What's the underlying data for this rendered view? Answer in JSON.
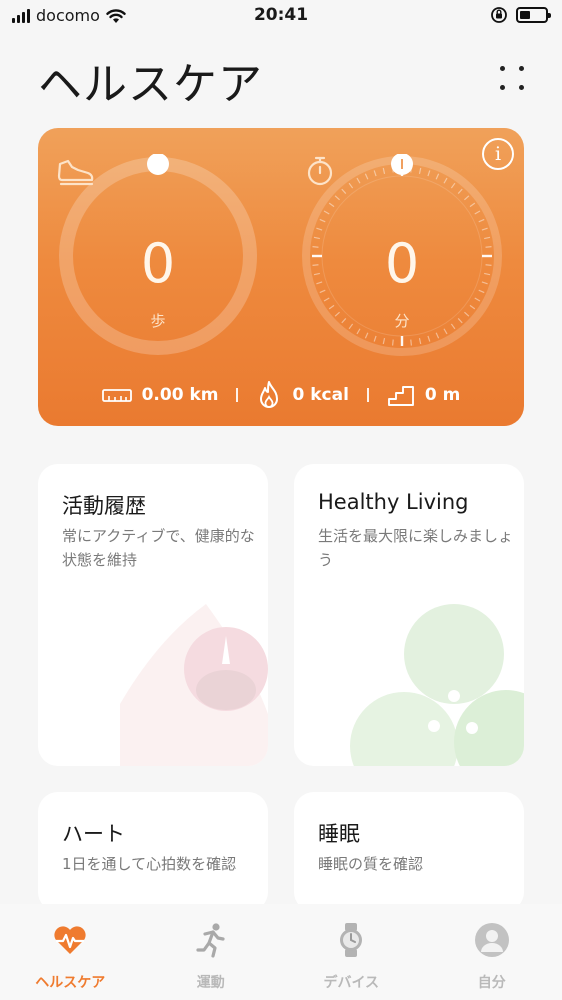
{
  "status_bar": {
    "carrier": "docomo",
    "time": "20:41"
  },
  "header": {
    "title": "ヘルスケア"
  },
  "activity": {
    "steps_value": "0",
    "steps_unit": "歩",
    "minutes_value": "0",
    "minutes_unit": "分",
    "distance": "0.00 km",
    "calories": "0 kcal",
    "climb": "0 m",
    "accent_color": "#ee8a3e"
  },
  "cards": {
    "history": {
      "title": "活動履歴",
      "desc": "常にアクティブで、健康的な状態を維持"
    },
    "living": {
      "title": "Healthy Living",
      "desc": "生活を最大限に楽しみましょう"
    },
    "heart": {
      "title": "ハート",
      "desc": "1日を通して心拍数を確認"
    },
    "sleep": {
      "title": "睡眠",
      "desc": "睡眠の質を確認"
    }
  },
  "nav": {
    "items": [
      {
        "label": "ヘルスケア",
        "icon": "heart-pulse-icon"
      },
      {
        "label": "運動",
        "icon": "running-icon"
      },
      {
        "label": "デバイス",
        "icon": "watch-icon"
      },
      {
        "label": "自分",
        "icon": "profile-icon"
      }
    ],
    "active_color": "#ef7b2f"
  }
}
